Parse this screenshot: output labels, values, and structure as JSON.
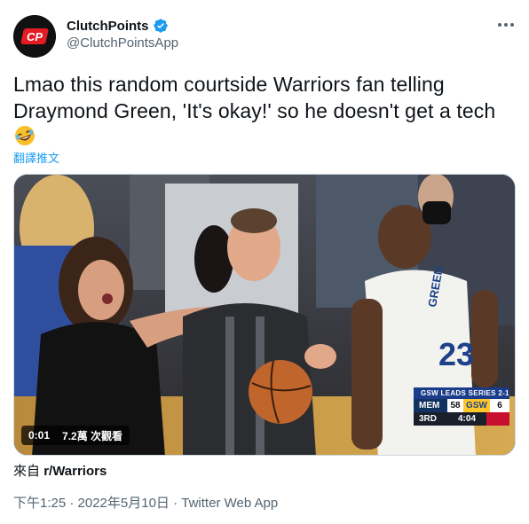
{
  "colors": {
    "brand_red": "#e31b23",
    "link_blue": "#1d9bf0",
    "secondary_text": "#536471"
  },
  "tweet": {
    "author": {
      "display_name": "ClutchPoints",
      "handle": "@ClutchPointsApp",
      "verified": true,
      "avatar_icon": "clutchpoints-logo"
    },
    "text": "Lmao this random courtside Warriors fan telling Draymond Green, 'It's okay!' so he doesn't get a tech",
    "emoji": "🤣",
    "translate_label": "翻譯推文",
    "media": {
      "type": "video",
      "duration": "0:01",
      "views": "7.2萬 次觀看",
      "scorebug": {
        "title": "GSW LEADS SERIES 2-1",
        "home_team": "MEM",
        "home_score": "58",
        "away_team": "GSW",
        "away_score": "6",
        "period": "3RD",
        "clock": "4:04"
      },
      "jersey_name": "GREEN",
      "jersey_number": "23"
    },
    "source_prefix": "來自",
    "source_subreddit": "r/Warriors",
    "timestamp": "下午1:25 · 2022年5月10日 · ",
    "client": "Twitter Web App"
  }
}
